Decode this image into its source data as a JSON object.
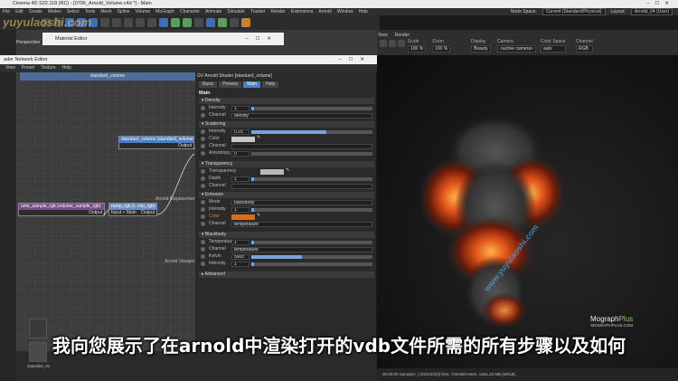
{
  "window": {
    "title": "Cinema 4D S22.118 (RC) - [0706_Arnold_Volume.c4d *] - Main"
  },
  "menu": [
    "File",
    "Edit",
    "Create",
    "Modes",
    "Select",
    "Tools",
    "Mesh",
    "Spline",
    "Volume",
    "MoGraph",
    "Character",
    "Animate",
    "Simulate",
    "Tracker",
    "Render",
    "Extensions",
    "Arnold",
    "Window",
    "Help"
  ],
  "menu_right": {
    "node_space_label": "Node Space:",
    "node_space_value": "Current (Standard/Physical)",
    "layout_label": "Layout:",
    "layout_value": "Arnold_04 (User)"
  },
  "viewport": {
    "label": "Perspective",
    "tabs": [
      "View",
      "Cam"
    ]
  },
  "material_editor": {
    "title": "Material Editor"
  },
  "shader_network": {
    "title": "ader Network Editor",
    "menu": [
      "View",
      "Preset",
      "Texture",
      "Help"
    ],
    "graph_header": "standard_volume"
  },
  "nodes": {
    "standard_volume": {
      "title": "standard_volume (standard_volume)",
      "port": "Output"
    },
    "volume_sample": {
      "title": "ume_sample_rgb (volume_sample_rgb)",
      "port": "Output"
    },
    "ramp": {
      "title": "ramp_rgb (r...mp_rgb)",
      "port_in": "Input + Main",
      "port_out": "Output"
    },
    "labels": {
      "displacement": "Arnold Displacement",
      "viewport": "Arnold Viewport"
    }
  },
  "attributes": {
    "title": "GV Arnold Shader [standard_volume]",
    "tabs": [
      "Basic",
      "Presets",
      "Main",
      "Help"
    ],
    "active_tab": "Main",
    "heading": "Main",
    "sections": {
      "density": "▾ Density",
      "scattering": "▾ Scattering",
      "transparency": "▾ Transparency",
      "emission": "▾ Emission",
      "blackbody": "▾ Blackbody",
      "advanced": "▸ Advanced"
    },
    "rows": {
      "d_intensity": {
        "name": "Intensity",
        "value": "1",
        "level": 0.02
      },
      "d_channel": {
        "name": "Channel",
        "value": "density"
      },
      "s_intensity": {
        "name": "Intensity",
        "value": "0.25",
        "level": 0.62
      },
      "s_color": {
        "name": "Color",
        "value": ""
      },
      "s_channel": {
        "name": "Channel",
        "value": ""
      },
      "s_aniso": {
        "name": "Anisotropy",
        "value": "0",
        "level": 0.0
      },
      "t_transparency": {
        "name": "Transparency",
        "value": ""
      },
      "t_depth": {
        "name": "Depth",
        "value": "1",
        "level": 0.02
      },
      "t_channel": {
        "name": "Channel",
        "value": ""
      },
      "e_mode": {
        "name": "Mode",
        "value": "blackbody"
      },
      "e_intensity": {
        "name": "Intensity",
        "value": "1",
        "level": 0.02
      },
      "e_color": {
        "name": "Color",
        "value": ""
      },
      "e_channel": {
        "name": "Channel",
        "value": "temperature"
      },
      "b_intensity": {
        "name": "Temperature",
        "value": "1",
        "level": 0.02
      },
      "b_channel": {
        "name": "Channel",
        "value": "temperature"
      },
      "b_kelvin": {
        "name": "Kelvin",
        "value": "5000",
        "level": 0.42
      },
      "b_bintensity": {
        "name": "Intensity",
        "value": "1",
        "level": 0.02
      }
    },
    "colors": {
      "scatter": "#c8c8c8",
      "transparency": "#b8b8b8",
      "emission": "#e06a18"
    }
  },
  "render_view": {
    "menu": [
      "View",
      "Render"
    ],
    "controls": [
      {
        "label": "Scale",
        "value": "100 %"
      },
      {
        "label": "Zoom",
        "value": "100 %"
      },
      {
        "label": "Display",
        "value": "Beauty"
      },
      {
        "label": "Camera",
        "value": "<active camera>"
      },
      {
        "label": "Color Space",
        "value": "auto"
      },
      {
        "label": "Channel",
        "value": "RGB"
      }
    ],
    "status": "00:00:00  Samples: [-2/2/2/2/2/2]  Res: 720x960  Mem: 1661.20 MB  [sRGB]",
    "brand_main": "Mograph",
    "brand_accent": "Plus",
    "brand_sub": "MOGRAPHPLUS.COM",
    "watermark": "www.yuyulaoshi.com"
  },
  "site_watermark": "yuyulaoshi.com",
  "materials": {
    "label": "Gasoline_01"
  },
  "subtitle": "我向您展示了在arnold中渲染打开的vdb文件所需的所有步骤以及如何"
}
